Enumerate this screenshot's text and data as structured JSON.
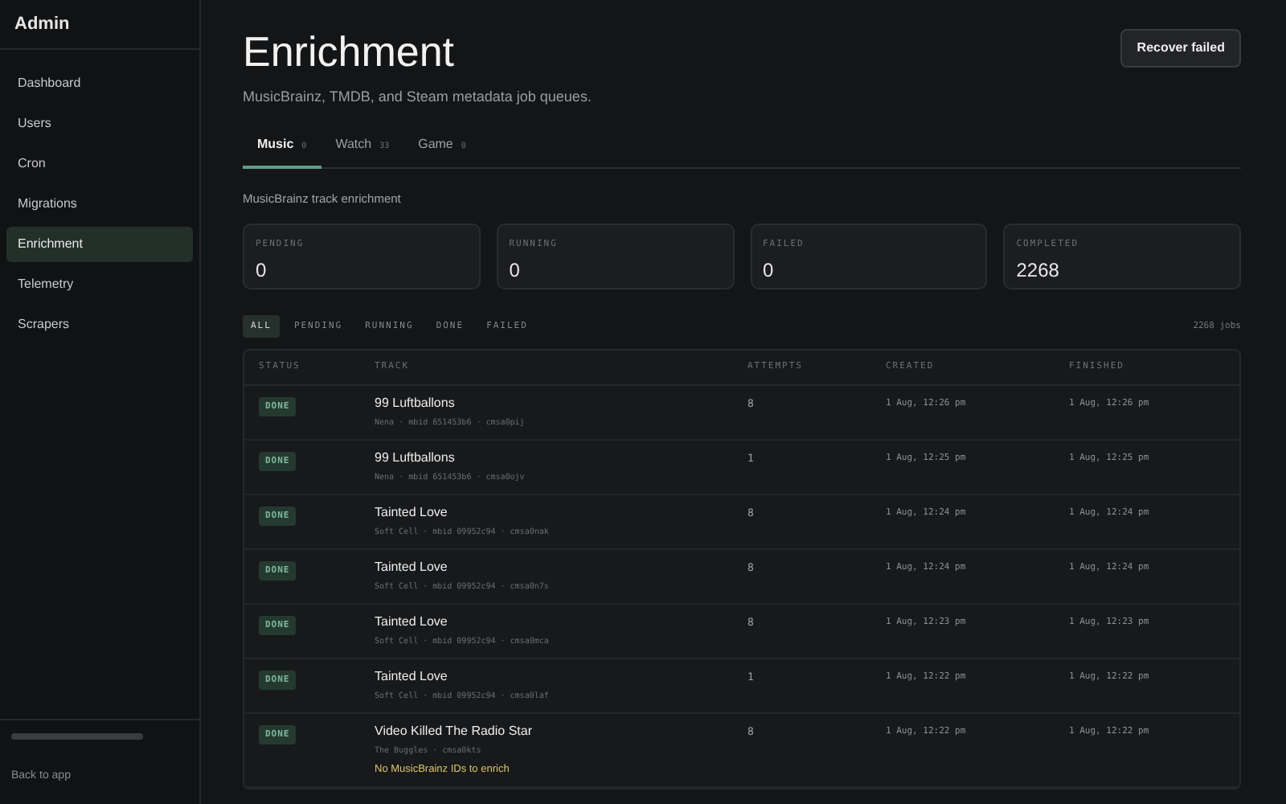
{
  "sidebar": {
    "title": "Admin",
    "items": [
      {
        "label": "Dashboard",
        "selected": false
      },
      {
        "label": "Users",
        "selected": false
      },
      {
        "label": "Cron",
        "selected": false
      },
      {
        "label": "Migrations",
        "selected": false
      },
      {
        "label": "Enrichment",
        "selected": true
      },
      {
        "label": "Telemetry",
        "selected": false
      },
      {
        "label": "Scrapers",
        "selected": false
      }
    ],
    "footer_link": "Back to app"
  },
  "header": {
    "title": "Enrichment",
    "subtitle": "MusicBrainz, TMDB, and Steam metadata job queues.",
    "action": "Recover failed"
  },
  "tabs": [
    {
      "label": "Music",
      "count": "0",
      "selected": true
    },
    {
      "label": "Watch",
      "count": "33",
      "selected": false
    },
    {
      "label": "Game",
      "count": "0",
      "selected": false
    }
  ],
  "section_title": "MusicBrainz track enrichment",
  "stats": [
    {
      "label": "PENDING",
      "value": "0"
    },
    {
      "label": "RUNNING",
      "value": "0"
    },
    {
      "label": "FAILED",
      "value": "0"
    },
    {
      "label": "COMPLETED",
      "value": "2268"
    }
  ],
  "filters": [
    {
      "label": "ALL",
      "selected": true
    },
    {
      "label": "PENDING",
      "selected": false
    },
    {
      "label": "RUNNING",
      "selected": false
    },
    {
      "label": "DONE",
      "selected": false
    },
    {
      "label": "FAILED",
      "selected": false
    }
  ],
  "job_count": "2268 jobs",
  "table": {
    "columns": [
      "STATUS",
      "TRACK",
      "ATTEMPTS",
      "CREATED",
      "FINISHED"
    ],
    "rows": [
      {
        "status": "DONE",
        "title": "99 Luftballons",
        "meta": "Nena · mbid 651453b6 · cmsa0pij",
        "attempts": "8",
        "created": "1 Aug, 12:26 pm",
        "finished": "1 Aug, 12:26 pm"
      },
      {
        "status": "DONE",
        "title": "99 Luftballons",
        "meta": "Nena · mbid 651453b6 · cmsa0ojv",
        "attempts": "1",
        "created": "1 Aug, 12:25 pm",
        "finished": "1 Aug, 12:25 pm"
      },
      {
        "status": "DONE",
        "title": "Tainted Love",
        "meta": "Soft Cell · mbid 09952c94 · cmsa0nak",
        "attempts": "8",
        "created": "1 Aug, 12:24 pm",
        "finished": "1 Aug, 12:24 pm"
      },
      {
        "status": "DONE",
        "title": "Tainted Love",
        "meta": "Soft Cell · mbid 09952c94 · cmsa0n7s",
        "attempts": "8",
        "created": "1 Aug, 12:24 pm",
        "finished": "1 Aug, 12:24 pm"
      },
      {
        "status": "DONE",
        "title": "Tainted Love",
        "meta": "Soft Cell · mbid 09952c94 · cmsa0mca",
        "attempts": "8",
        "created": "1 Aug, 12:23 pm",
        "finished": "1 Aug, 12:23 pm"
      },
      {
        "status": "DONE",
        "title": "Tainted Love",
        "meta": "Soft Cell · mbid 09952c94 · cmsa0laf",
        "attempts": "1",
        "created": "1 Aug, 12:22 pm",
        "finished": "1 Aug, 12:22 pm"
      },
      {
        "status": "DONE",
        "title": "Video Killed The Radio Star",
        "meta": "The Buggles · cmsa0kts",
        "note": "No MusicBrainz IDs to enrich",
        "attempts": "8",
        "created": "1 Aug, 12:22 pm",
        "finished": "1 Aug, 12:22 pm"
      }
    ]
  }
}
